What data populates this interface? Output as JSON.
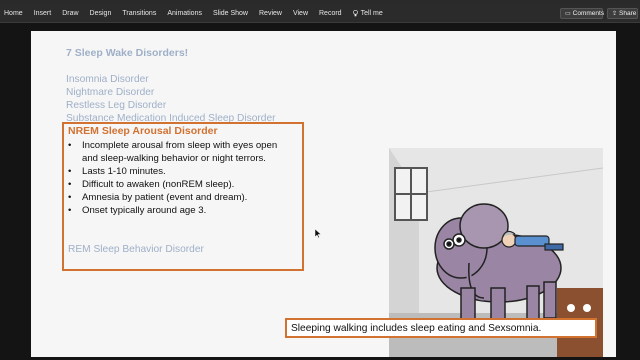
{
  "ribbon": {
    "tabs": [
      "Home",
      "Insert",
      "Draw",
      "Design",
      "Transitions",
      "Animations",
      "Slide Show",
      "Review",
      "View",
      "Record"
    ],
    "tell_me": "Tell me",
    "comments": "Comments",
    "share": "Share"
  },
  "slide": {
    "title": "7 Sleep Wake Disorders!",
    "disorders": [
      "Insomnia Disorder",
      "Nightmare Disorder",
      "Restless Leg Disorder",
      "Substance Medication Induced Sleep Disorder"
    ],
    "highlight": {
      "heading": "NREM Sleep Arousal Disorder",
      "bullets": [
        "Incomplete arousal from sleep with eyes open",
        "and sleep-walking behavior or night terrors.",
        "Lasts 1-10 minutes.",
        "Difficult to awaken (nonREM sleep).",
        "Amnesia by patient (event and dream).",
        "Onset typically around age 3."
      ],
      "rem": "REM Sleep Behavior Disorder"
    },
    "caption": "Sleeping walking includes sleep eating and Sexsomnia."
  },
  "colors": {
    "accent_orange": "#d27230",
    "muted_blue": "#9fb0c7",
    "ribbon_bg": "#2b2b2b"
  }
}
